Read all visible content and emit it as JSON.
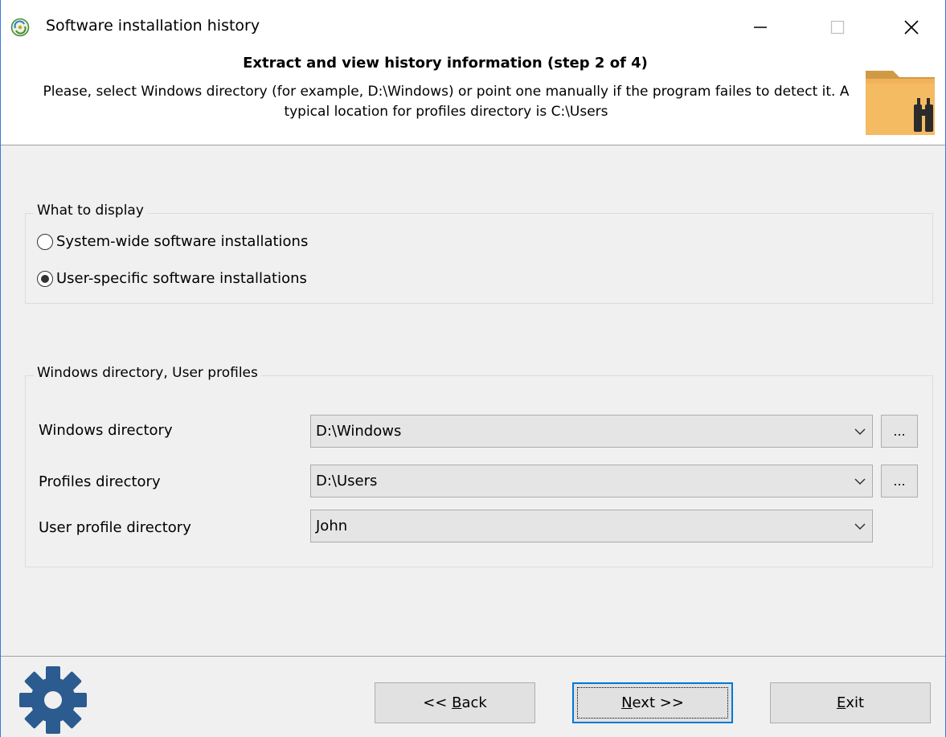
{
  "window": {
    "title": "Software installation history",
    "controls": {
      "minimize": "—",
      "maximize": "□",
      "close": "✕"
    }
  },
  "header": {
    "title": "Extract and view history information (step 2 of 4)",
    "description": "Please, select Windows directory (for example, D:\\Windows) or point one manually if the program failes to detect it. A typical location for profiles directory is C:\\Users",
    "icon": "folder-binoculars-icon"
  },
  "display_group": {
    "label": "What to display",
    "options": [
      {
        "label": "System-wide software installations",
        "selected": false
      },
      {
        "label": "User-specific software installations",
        "selected": true
      }
    ]
  },
  "directories_group": {
    "label": "Windows directory, User profiles",
    "fields": [
      {
        "label": "Windows directory",
        "value": "D:\\Windows",
        "browse": "..."
      },
      {
        "label": "Profiles directory",
        "value": "D:\\Users",
        "browse": "..."
      },
      {
        "label": "User profile directory",
        "value": "John"
      }
    ]
  },
  "footer": {
    "icon": "gear-icon",
    "back": {
      "pre": "<< ",
      "accel": "B",
      "post": "ack"
    },
    "next": {
      "pre": "",
      "accel": "N",
      "post": "ext >>"
    },
    "exit": {
      "pre": "",
      "accel": "E",
      "post": "xit"
    }
  },
  "colors": {
    "accent": "#0078d7",
    "folder": "#f0b35a",
    "gear": "#2b5b8f"
  }
}
